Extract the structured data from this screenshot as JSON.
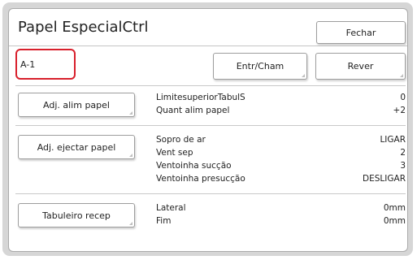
{
  "window": {
    "title": "Papel EspecialCtrl",
    "close_label": "Fechar"
  },
  "selection": {
    "value": "A-1"
  },
  "actions": {
    "enter_call_label": "Entr/Cham",
    "review_label": "Rever"
  },
  "sections": [
    {
      "button_label": "Adj. alim papel",
      "items": [
        {
          "label": "LimitesuperiorTabulS",
          "value": "0"
        },
        {
          "label": "Quant alim papel",
          "value": "+2"
        }
      ]
    },
    {
      "button_label": "Adj. ejectar papel",
      "items": [
        {
          "label": "Sopro de ar",
          "value": "LIGAR"
        },
        {
          "label": "Vent sep",
          "value": "2"
        },
        {
          "label": "Ventoinha sucção",
          "value": "3"
        },
        {
          "label": "Ventoinha presucção",
          "value": "DESLIGAR"
        }
      ]
    },
    {
      "button_label": "Tabuleiro recep",
      "items": [
        {
          "label": "Lateral",
          "value": "0mm"
        },
        {
          "label": "Fim",
          "value": "0mm"
        }
      ]
    }
  ],
  "colors": {
    "highlight_border": "#d8202c",
    "frame_bg": "#d6d6d6"
  }
}
